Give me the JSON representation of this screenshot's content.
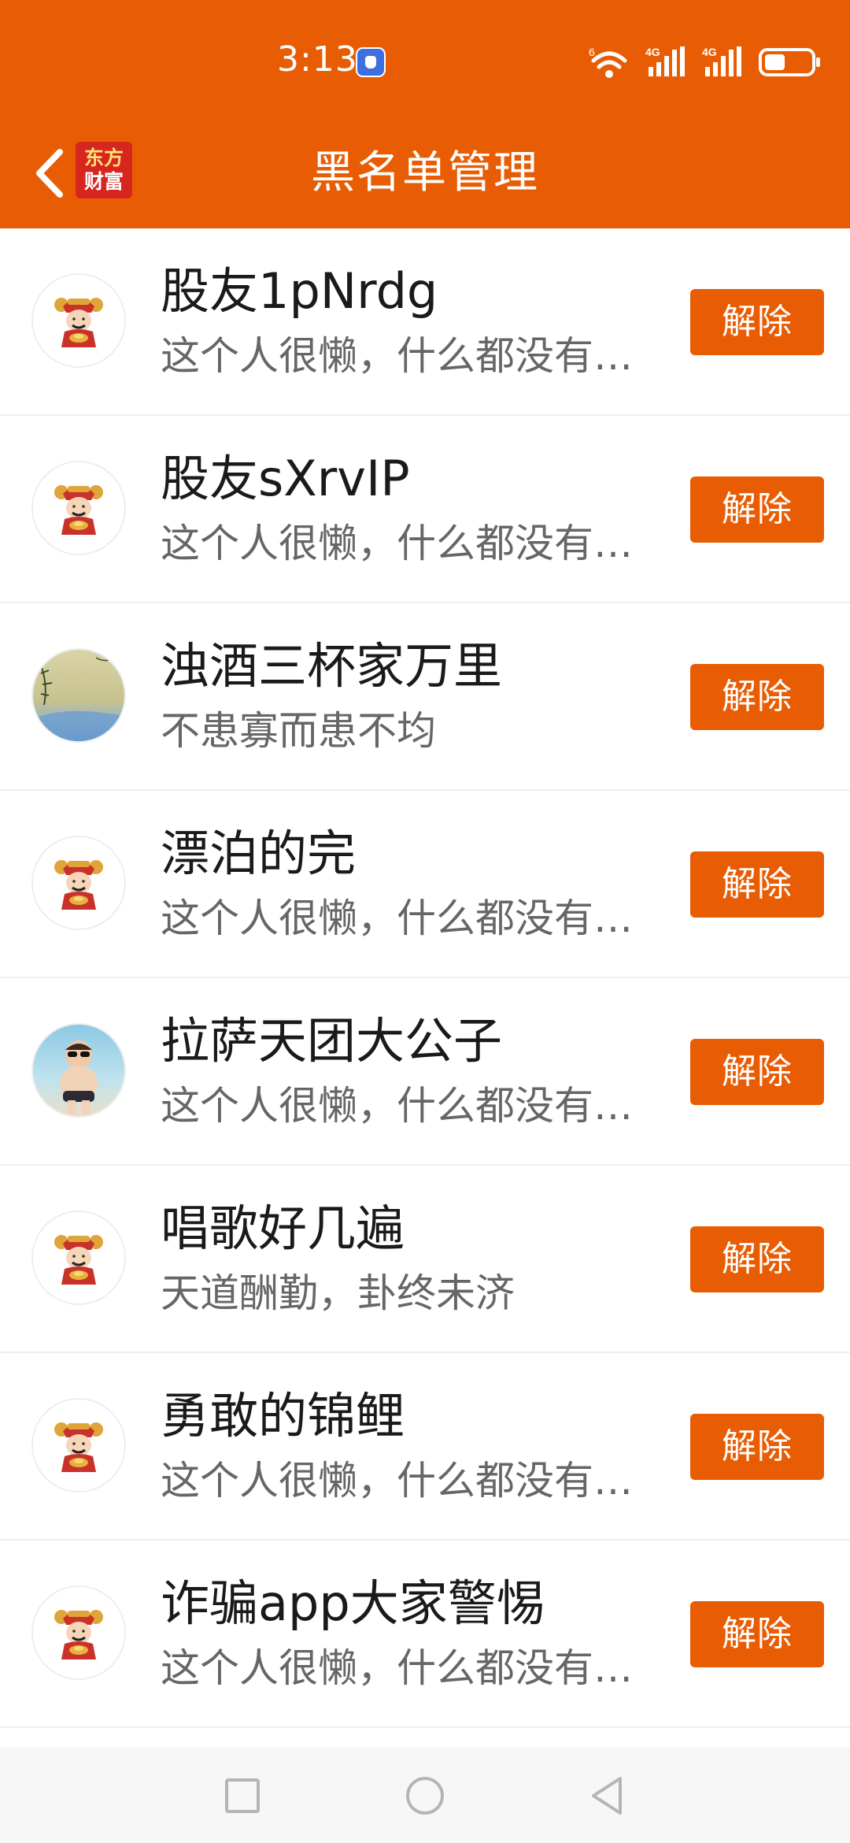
{
  "status_bar": {
    "time": "3:13",
    "wifi_label": "6",
    "signal1_label": "4G",
    "signal2_label": "4G",
    "battery_level": 0.45
  },
  "header": {
    "title": "黑名单管理",
    "logo_line1": "东方",
    "logo_line2": "财富",
    "background_color": "#E85D04"
  },
  "blacklist": [
    {
      "name": "股友1pNrdg",
      "description": "这个人很懒，什么都没有留下",
      "avatar": "caishen-avatar",
      "button_label": "解除"
    },
    {
      "name": "股友sXrvIP",
      "description": "这个人很懒，什么都没有留下",
      "avatar": "caishen-avatar",
      "button_label": "解除"
    },
    {
      "name": "浊酒三杯家万里",
      "description": "不患寡而患不均",
      "avatar": "landscape-avatar",
      "button_label": "解除"
    },
    {
      "name": "漂泊的完",
      "description": "这个人很懒，什么都没有留下",
      "avatar": "caishen-avatar",
      "button_label": "解除"
    },
    {
      "name": "拉萨天团大公子",
      "description": "这个人很懒，什么都没有留下",
      "avatar": "child-photo-avatar",
      "button_label": "解除"
    },
    {
      "name": "唱歌好几遍",
      "description": "天道酬勤，卦终未济",
      "avatar": "caishen-avatar",
      "button_label": "解除"
    },
    {
      "name": "勇敢的锦鲤",
      "description": "这个人很懒，什么都没有留下",
      "avatar": "caishen-avatar",
      "button_label": "解除"
    },
    {
      "name": "诈骗app大家警惕",
      "description": "这个人很懒，什么都没有留下",
      "avatar": "caishen-avatar",
      "button_label": "解除"
    }
  ],
  "nav_bar": {
    "recent_icon": "square-icon",
    "home_icon": "circle-icon",
    "back_icon": "triangle-back-icon"
  }
}
